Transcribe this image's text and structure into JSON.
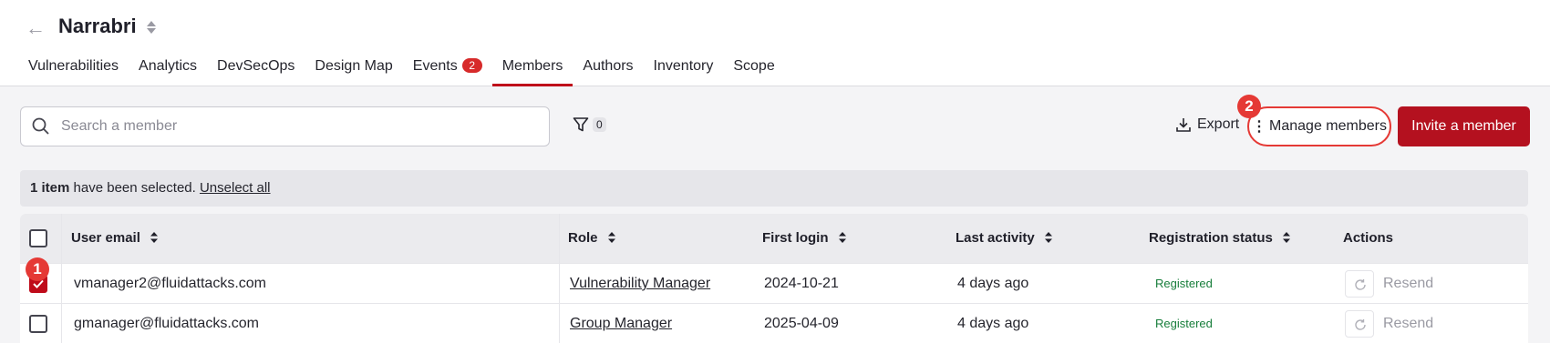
{
  "header": {
    "title": "Narrabri"
  },
  "tabs": [
    {
      "label": "Vulnerabilities"
    },
    {
      "label": "Analytics"
    },
    {
      "label": "DevSecOps"
    },
    {
      "label": "Design Map"
    },
    {
      "label": "Events",
      "badge": "2"
    },
    {
      "label": "Members",
      "active": true
    },
    {
      "label": "Authors"
    },
    {
      "label": "Inventory"
    },
    {
      "label": "Scope"
    }
  ],
  "search": {
    "placeholder": "Search a member",
    "value": ""
  },
  "filter": {
    "count": "0"
  },
  "toolbar": {
    "export_label": "Export",
    "manage_label": "Manage members",
    "invite_label": "Invite a member"
  },
  "steps": {
    "first": "1",
    "second": "2"
  },
  "selection": {
    "count_text": "1 item",
    "text": " have been selected. ",
    "unselect_label": "Unselect all"
  },
  "table": {
    "columns": [
      "User email",
      "Role",
      "First login",
      "Last activity",
      "Registration status",
      "Actions"
    ],
    "rows": [
      {
        "email": "vmanager2@fluidattacks.com",
        "role": "Vulnerability Manager",
        "first_login": "2024-10-21",
        "last_activity": "4 days ago",
        "status": "Registered",
        "action": "Resend",
        "selected": true
      },
      {
        "email": "gmanager@fluidattacks.com",
        "role": "Group Manager",
        "first_login": "2025-04-09",
        "last_activity": "4 days ago",
        "status": "Registered",
        "action": "Resend",
        "selected": false
      }
    ]
  },
  "colors": {
    "accent": "#b4111f",
    "highlight": "#e53935",
    "status_green": "#177e3b"
  },
  "icons": [
    "back-arrow-icon",
    "sort-icon",
    "search-icon",
    "filter-icon",
    "download-icon",
    "kebab-icon",
    "check-icon",
    "refresh-icon"
  ]
}
